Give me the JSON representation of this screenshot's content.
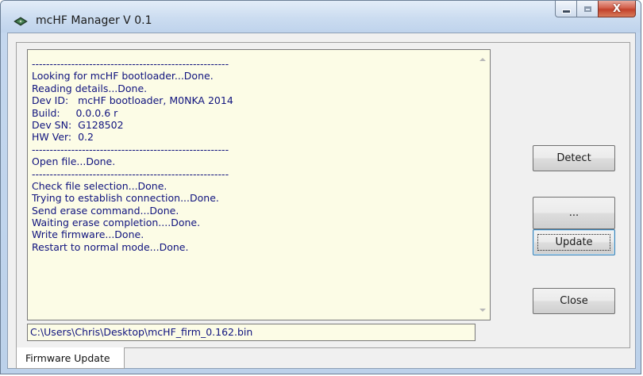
{
  "window": {
    "title": "mcHF Manager V 0.1",
    "icon": "circuit-board-icon",
    "caption_buttons": {
      "minimize": "minimize-icon",
      "maximize": "maximize-icon",
      "close": "X"
    }
  },
  "log": {
    "lines": [
      "-------------------------------------------------------",
      "Looking for mcHF bootloader...Done.",
      "Reading details...Done.",
      "Dev ID:   mcHF bootloader, M0NKA 2014",
      "Build:     0.0.0.6 r",
      "Dev SN:  G128502",
      "HW Ver:  0.2",
      "-------------------------------------------------------",
      "Open file...Done.",
      "-------------------------------------------------------",
      "Check file selection...Done.",
      "Trying to establish connection...Done.",
      "Send erase command...Done.",
      "Waiting erase completion....Done.",
      "Write firmware...Done.",
      "Restart to normal mode...Done."
    ]
  },
  "file_path": "C:\\Users\\Chris\\Desktop\\mcHF_firm_0.162.bin",
  "buttons": {
    "detect": "Detect",
    "browse": "...",
    "update": "Update",
    "close": "Close"
  },
  "tabs": [
    {
      "label": "Firmware Update",
      "selected": true
    }
  ],
  "colors": {
    "log_background": "#fcfce6",
    "log_text": "#10137e",
    "close_button": "#c7432d"
  }
}
